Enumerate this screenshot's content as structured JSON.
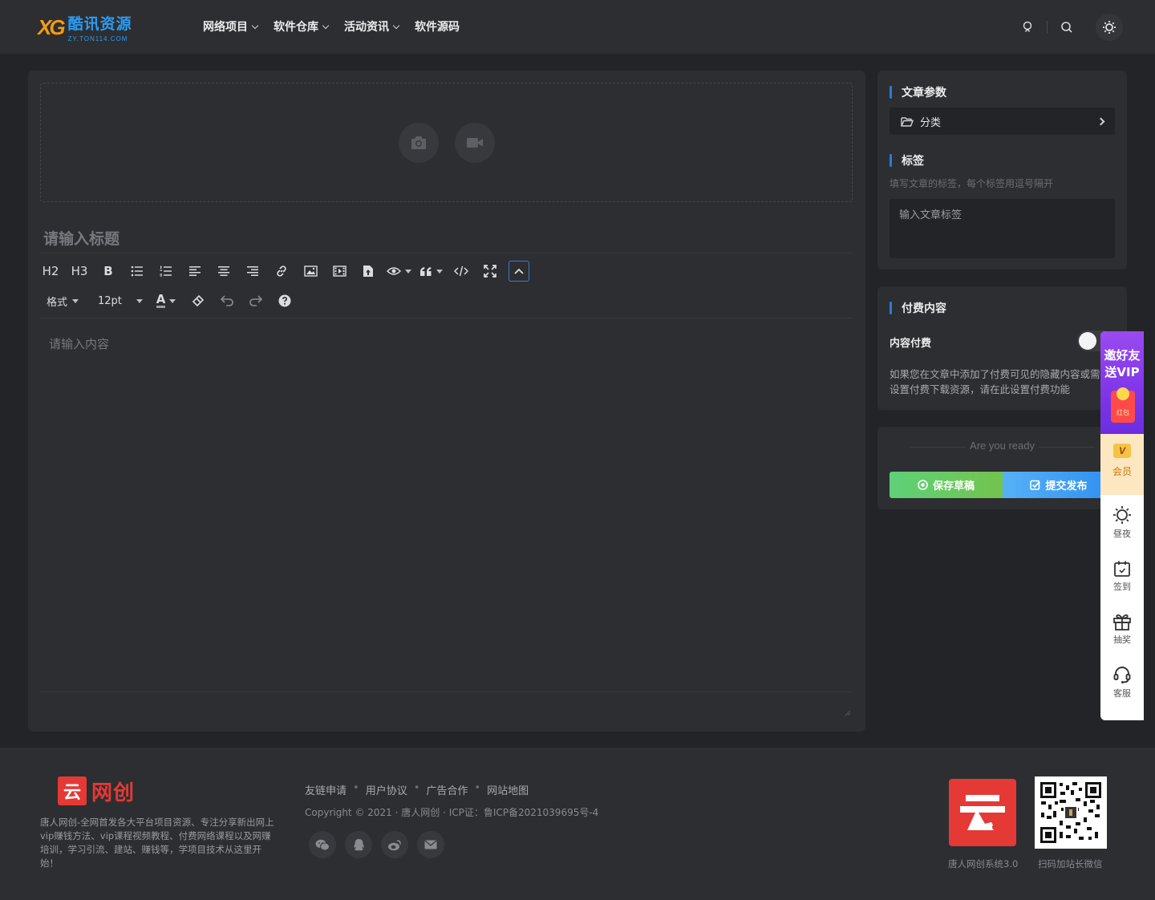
{
  "header": {
    "logo_mark": "XG",
    "logo_cn": "酷讯资源",
    "logo_en": "ZY.TON114.COM",
    "nav": [
      {
        "label": "网络项目",
        "has_dropdown": true
      },
      {
        "label": "软件仓库",
        "has_dropdown": true
      },
      {
        "label": "活动资讯",
        "has_dropdown": true
      },
      {
        "label": "软件源码",
        "has_dropdown": false
      }
    ],
    "icons": [
      "user-icon",
      "search-icon",
      "theme-toggle-icon"
    ]
  },
  "editor": {
    "cover_buttons": [
      "camera-icon",
      "video-icon"
    ],
    "title_placeholder": "请输入标题",
    "toolbar_row1": {
      "h2": "H2",
      "h3": "H3",
      "bold": "B",
      "buttons": [
        "bullet-list-icon",
        "numbered-list-icon",
        "align-left-icon",
        "align-center-icon",
        "align-right-icon",
        "link-icon",
        "image-icon",
        "video-insert-icon",
        "file-upload-icon",
        "hide-content-icon",
        "quote-icon",
        "code-icon",
        "fullscreen-icon",
        "collapse-toolbar-icon"
      ]
    },
    "toolbar_row2": {
      "format_label": "格式",
      "font_size": "12pt",
      "font_color_label": "A",
      "buttons": [
        "eraser-icon",
        "undo-icon",
        "redo-icon",
        "help-icon"
      ]
    },
    "content_placeholder": "请输入内容"
  },
  "sidebar": {
    "params_title": "文章参数",
    "category_label": "分类",
    "tags_title": "标签",
    "tags_hint": "填写文章的标签，每个标签用逗号隔开",
    "tags_placeholder": "输入文章标签",
    "paid_title": "付费内容",
    "paid_label": "内容付费",
    "paid_enabled": false,
    "paid_desc": "如果您在文章中添加了付费可见的隐藏内容或需设置付费下载资源，请在此设置付费功能",
    "ready_text": "Are you ready",
    "draft_button": "保存草稿",
    "publish_button": "提交发布"
  },
  "float_bar": {
    "promo_text": "邀好友送VIP",
    "promo_envelope": "红包",
    "vip_badge": "V",
    "vip_label": "会员",
    "items": [
      {
        "label": "昼夜",
        "icon": "sun-icon"
      },
      {
        "label": "签到",
        "icon": "calendar-icon"
      },
      {
        "label": "抽奖",
        "icon": "gift-icon"
      },
      {
        "label": "客服",
        "icon": "headset-icon"
      }
    ]
  },
  "footer": {
    "logo_glyph": "云",
    "logo_text": "网创",
    "description": "唐人网创-全网首发各大平台项目资源、专注分享新出网上vip赚钱方法、vip课程视频教程、付费网络课程以及网赚培训，学习引流、建站、赚钱等，学项目技术从这里开始！",
    "links": [
      "友链申请",
      "用户协议",
      "广告合作",
      "网站地图"
    ],
    "copyright": "Copyright © 2021 · 唐人网创 · ICP证：鲁ICP备2021039695号-4",
    "social": [
      "wechat-icon",
      "qq-icon",
      "weibo-icon",
      "email-icon"
    ],
    "brand_caption": "唐人网创系统3.0",
    "qr_caption": "扫码加站长微信"
  },
  "colors": {
    "page_bg": "#232427",
    "panel_bg": "#2d2e31",
    "accent_blue": "#2d7ad6",
    "draft_green": "#5fd079",
    "publish_blue": "#2e8ff0",
    "brand_red": "#e53935"
  }
}
